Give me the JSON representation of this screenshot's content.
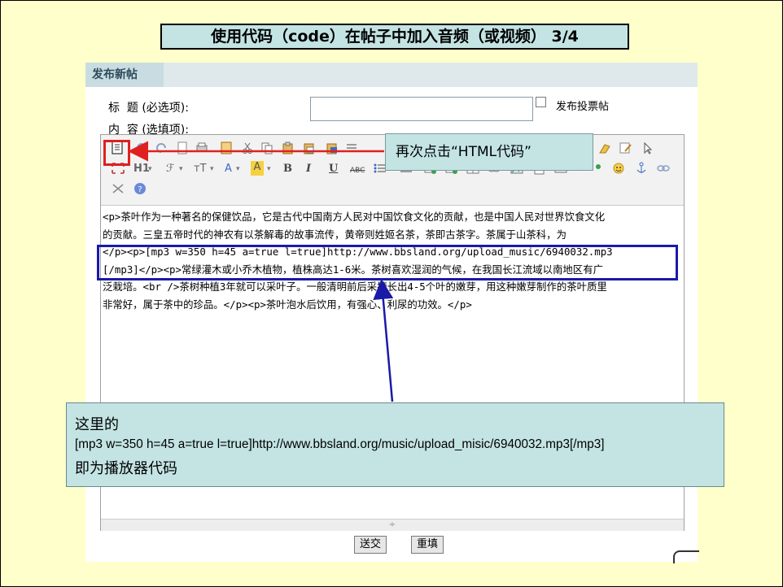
{
  "slide": {
    "title": "使用代码（code）在帖子中加入音频（或视频） 3/4"
  },
  "forum": {
    "tab_label": "发布新帖",
    "subject_label": "标  题 (必选项):",
    "content_label": "内  容 (选填项):",
    "subject_value": "",
    "poll_checked": false,
    "poll_label": "发布投票帖",
    "toolbar": {
      "heading_label": "H1",
      "font_label": "ℱ",
      "size_label": "тT",
      "color_label": "A",
      "highlight_label": "A",
      "bold_label": "B",
      "italic_label": "I",
      "underline_label": "U",
      "strike_label": "ABC"
    },
    "code_lines": [
      "<p>茶叶作为一种著名的保健饮品，它是古代中国南方人民对中国饮食文化的贡献，也是中国人民对世界饮食文化",
      "的贡献。三皇五帝时代的神农有以茶解毒的故事流传，黄帝则姓姬名茶，茶即古茶字。茶属于山茶科，为",
      "</p><p>[mp3 w=350 h=45 a=true l=true]http://www.bbsland.org/upload_music/6940032.mp3",
      "[/mp3]</p><p>常绿灌木或小乔木植物，植株高达1-6米。茶树喜欢湿润的气候，在我国长江流域以南地区有广",
      "泛栽培。<br />茶树种植3年就可以采叶子。一般清明前后采摘长出4-5个叶的嫩芽，用这种嫩芽制作的茶叶质里",
      "非常好，属于茶中的珍品。</p><p>茶叶泡水后饮用，有强心、利尿的功效。</p>"
    ],
    "submit_label": "送交",
    "reset_label": "重填"
  },
  "callout_html": {
    "text": "再次点击“HTML代码”"
  },
  "callout_player": {
    "line1": "这里的",
    "line2": "[mp3 w=350 h=45 a=true l=true]http://www.bbsland.org/music/upload_misic/6940032.mp3[/mp3]",
    "line3": "即为播放器代码"
  },
  "colors": {
    "slide_bg": "#ffffcc",
    "callout_bg": "#c4e4e4",
    "red_arrow": "#e02020",
    "blue_arrow": "#1a1aa8"
  }
}
